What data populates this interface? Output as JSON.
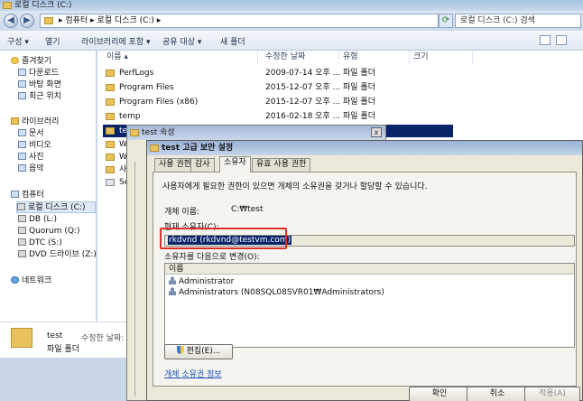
{
  "explorer": {
    "window_title": "로컬 디스크 (C:)",
    "address": "▸ 컴퓨터 ▸ 로컬 디스크 (C:) ▸",
    "search_placeholder": "로컬 디스크 (C:) 검색",
    "toolbar": {
      "organize": "구성 ▾",
      "open": "열기",
      "include_library": "라이브러리에 포함 ▾",
      "share": "공유 대상 ▾",
      "new_folder": "새 폴더"
    },
    "sidebar": {
      "favorites": "즐겨찾기",
      "downloads": "다운로드",
      "desktop": "바탕 화면",
      "recent": "최근 위치",
      "libraries": "라이브러리",
      "documents": "문서",
      "videos": "비디오",
      "pictures": "사진",
      "music": "음악",
      "computer": "컴퓨터",
      "local_disk": "로컬 디스크 (C:)",
      "db": "DB (L:)",
      "quorum": "Quorum (Q:)",
      "dtc": "DTC (S:)",
      "dvd": "DVD 드라이브 (Z:)",
      "network": "네트워크"
    },
    "columns": {
      "name": "이름",
      "modified": "수정한 날짜",
      "type": "유형",
      "size": "크기"
    },
    "rows": [
      {
        "name": "PerfLogs",
        "modified": "2009-07-14 오후 ...",
        "type": "파일 폴더"
      },
      {
        "name": "Program Files",
        "modified": "2015-12-07 오후 ...",
        "type": "파일 폴더"
      },
      {
        "name": "Program Files (x86)",
        "modified": "2015-12-07 오후 ...",
        "type": "파일 폴더"
      },
      {
        "name": "temp",
        "modified": "2016-02-18 오후 ...",
        "type": "파일 폴더"
      },
      {
        "name": "te",
        "modified": "",
        "type": ""
      },
      {
        "name": "W",
        "modified": "",
        "type": ""
      },
      {
        "name": "W",
        "modified": "",
        "type": ""
      },
      {
        "name": "사",
        "modified": "",
        "type": ""
      },
      {
        "name": "Se",
        "modified": "",
        "type": ""
      }
    ],
    "details": {
      "name": "test",
      "modified_label": "수정한 날짜:",
      "type": "파일 폴더"
    }
  },
  "properties_dialog": {
    "title": "test 속성",
    "close": "x"
  },
  "advanced_dialog": {
    "title": "test 고급 보안 설정",
    "tabs": [
      "사용 권한",
      "감사",
      "소유자",
      "유효 사용 권한"
    ],
    "description": "사용자에게 필요한 권한이 있으면 개체의 소유권을 갖거나 할당할 수 있습니다.",
    "object_name_label": "개체 이름:",
    "object_name_value": "C:₩test",
    "current_owner_label": "현재 소유자(C):",
    "current_owner_value": "rkdvnd (rkdvnd@testvm.com)",
    "change_owner_label": "소유자를 다음으로 변경(O):",
    "list_header": "이름",
    "owners": [
      "Administrator",
      "Administrators (N08SQL08SVR01₩Administrators)"
    ],
    "edit_button": "편집(E)...",
    "ownership_link": "개체 소유권 정보",
    "ok": "확인",
    "cancel": "취소",
    "apply": "적용(A)"
  },
  "colors": {
    "selection": "#0a246a",
    "highlight_box": "#d9302c",
    "dialog_bg": "#ece9d8"
  }
}
